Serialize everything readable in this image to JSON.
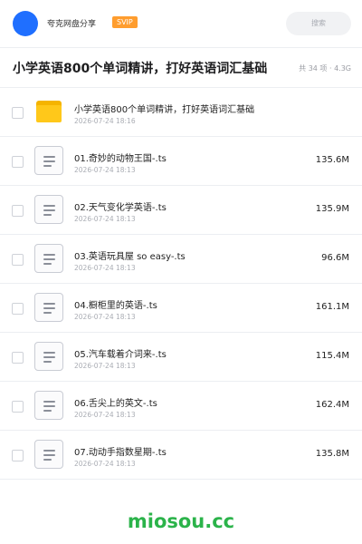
{
  "header": {
    "share_name": "夸克网盘分享",
    "badge": "SVIP",
    "search_placeholder": "搜索",
    "accent": "#1f6fff",
    "badge_color": "#ff9d2e"
  },
  "title": {
    "text": "小学英语800个单词精讲，打好英语词汇基础",
    "meta": "共 34 项 · 4.3G"
  },
  "files": [
    {
      "icon": "folder-icon",
      "name": "小学英语800个单词精讲，打好英语词汇基础",
      "date": "2026-07-24 18:16",
      "size": ""
    },
    {
      "icon": "document-icon",
      "name": "01.奇妙的动物王国-.ts",
      "date": "2026-07-24 18:13",
      "size": "135.6M"
    },
    {
      "icon": "document-icon",
      "name": "02.天气变化学英语-.ts",
      "date": "2026-07-24 18:13",
      "size": "135.9M"
    },
    {
      "icon": "document-icon",
      "name": "03.英语玩具屋 so easy-.ts",
      "date": "2026-07-24 18:13",
      "size": "96.6M"
    },
    {
      "icon": "document-icon",
      "name": "04.橱柜里的英语-.ts",
      "date": "2026-07-24 18:13",
      "size": "161.1M"
    },
    {
      "icon": "document-icon",
      "name": "05.汽车载着介词来-.ts",
      "date": "2026-07-24 18:13",
      "size": "115.4M"
    },
    {
      "icon": "document-icon",
      "name": "06.舌尖上的英文-.ts",
      "date": "2026-07-24 18:13",
      "size": "162.4M"
    },
    {
      "icon": "document-icon",
      "name": "07.动动手指数星期-.ts",
      "date": "2026-07-24 18:13",
      "size": "135.8M"
    }
  ],
  "watermark": {
    "text": "miosou.cc",
    "color": "#2bb34a"
  }
}
